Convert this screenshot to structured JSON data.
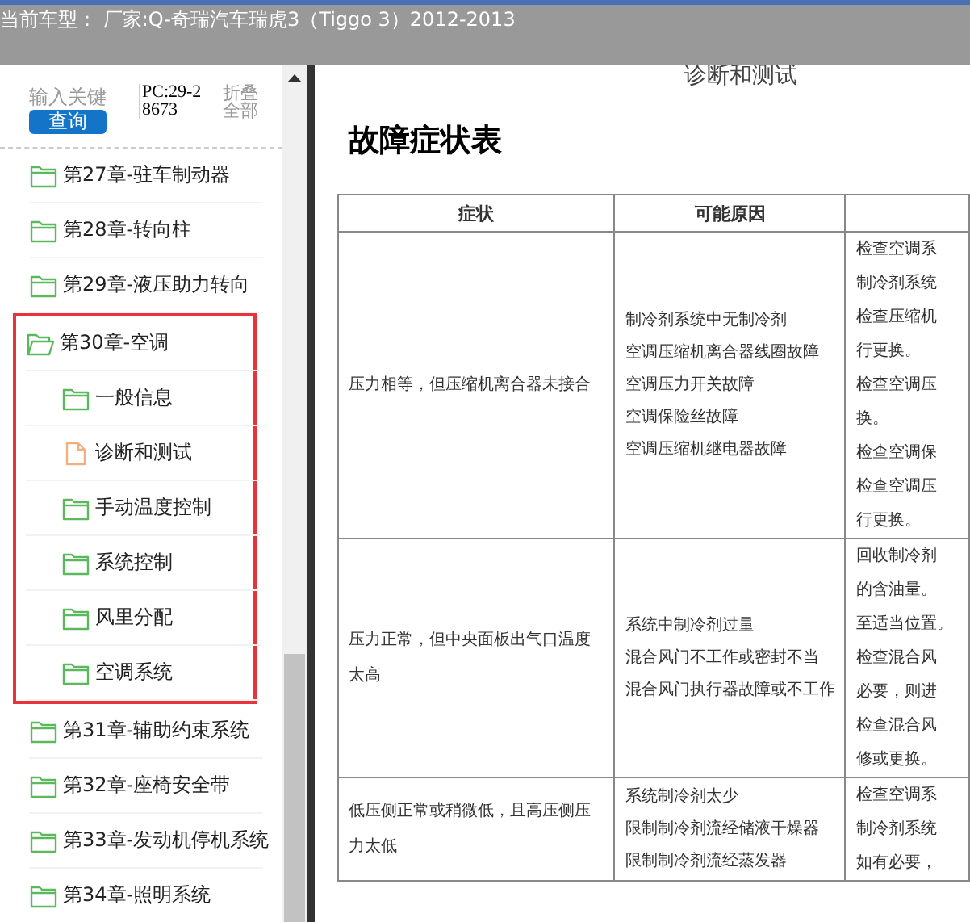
{
  "header": {
    "title": "当前车型： 厂家:Q-奇瑞汽车瑞虎3（Tiggo 3）2012-2013"
  },
  "sidebar": {
    "search": {
      "placeholder": "输入关键"
    },
    "search_button": "查询",
    "code": "PC:29-28673",
    "collapse_all": "折叠全部",
    "tree": [
      {
        "label": "第27章-驻车制动器",
        "kind": "folder",
        "expanded": false,
        "highlighted": false
      },
      {
        "label": "第28章-转向柱",
        "kind": "folder",
        "expanded": false,
        "highlighted": false
      },
      {
        "label": "第29章-液压助力转向",
        "kind": "folder",
        "expanded": false,
        "highlighted": false
      },
      {
        "label": "第30章-空调",
        "kind": "folder",
        "expanded": true,
        "highlighted": true,
        "children": [
          {
            "label": "一般信息",
            "kind": "folder",
            "expanded": false,
            "highlighted": false
          },
          {
            "label": "诊断和测试",
            "kind": "document",
            "highlighted": false
          },
          {
            "label": "手动温度控制",
            "kind": "folder",
            "expanded": false,
            "highlighted": false
          },
          {
            "label": "系统控制",
            "kind": "folder",
            "expanded": false,
            "highlighted": false
          },
          {
            "label": "风里分配",
            "kind": "folder",
            "expanded": false,
            "highlighted": false
          },
          {
            "label": "空调系统",
            "kind": "folder",
            "expanded": false,
            "highlighted": false
          }
        ]
      },
      {
        "label": "第31章-辅助约束系统",
        "kind": "folder",
        "expanded": false,
        "highlighted": false
      },
      {
        "label": "第32章-座椅安全带",
        "kind": "folder",
        "expanded": false,
        "highlighted": false
      },
      {
        "label": "第33章-发动机停机系统",
        "kind": "folder",
        "expanded": false,
        "highlighted": false
      },
      {
        "label": "第34章-照明系统",
        "kind": "folder",
        "expanded": false,
        "highlighted": false
      }
    ]
  },
  "document": {
    "heading": "诊断和测试",
    "title": "故障症状表",
    "table": {
      "columns": [
        "症状",
        "可能原因"
      ],
      "rows": [
        {
          "symptom": "压力相等，但压缩机离合器未接合",
          "causes": [
            "制冷剂系统中无制冷剂",
            "空调压缩机离合器线圈故障",
            "空调压力开关故障",
            "空调保险丝故障",
            "空调压缩机继电器故障"
          ],
          "column_3": [
            "检查空调系",
            "制冷剂系统",
            "检查压缩机",
            "行更换。",
            "检查空调压",
            "换。",
            "检查空调保",
            "检查空调压",
            "行更换。"
          ]
        },
        {
          "symptom": "压力正常，但中央面板出气口温度太高",
          "causes": [
            "系统中制冷剂过量",
            "混合风门不工作或密封不当",
            "混合风门执行器故障或不工作"
          ],
          "column_3": [
            "回收制冷剂",
            "的含油量。",
            "至适当位置。",
            "检查混合风",
            "必要，则进",
            "检查混合风",
            "修或更换。"
          ]
        },
        {
          "symptom": "低压侧正常或稍微低，且高压侧压力太低",
          "causes": [
            "系统制冷剂太少",
            "限制制冷剂流经储液干燥器",
            "限制制冷剂流经蒸发器"
          ],
          "column_3": [
            "检查空调系",
            "制冷剂系统",
            "如有必要，"
          ]
        }
      ]
    }
  }
}
